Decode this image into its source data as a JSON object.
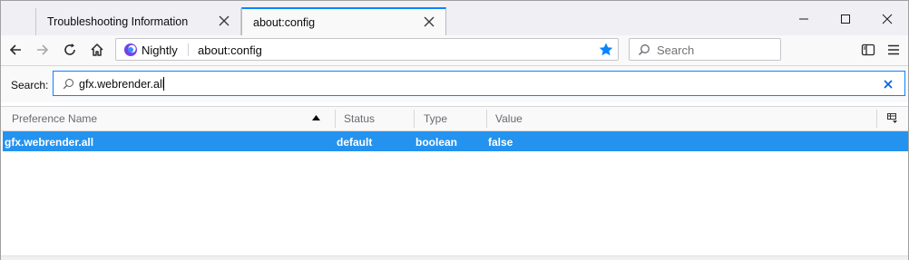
{
  "tabs": [
    {
      "label": "Troubleshooting Information",
      "active": false
    },
    {
      "label": "about:config",
      "active": true
    }
  ],
  "urlbar": {
    "identity": "Nightly",
    "url": "about:config"
  },
  "websearch": {
    "placeholder": "Search"
  },
  "config_search": {
    "label": "Search:",
    "value": "gfx.webrender.all"
  },
  "table": {
    "columns": [
      "Preference Name",
      "Status",
      "Type",
      "Value"
    ],
    "rows": [
      {
        "name": "gfx.webrender.all",
        "status": "default",
        "type": "boolean",
        "value": "false"
      }
    ]
  },
  "colors": {
    "accent": "#0a84ff",
    "selected_row": "#2493f0",
    "bookmark_star": "#0a84ff"
  },
  "icons": [
    "close-icon",
    "minimize-icon",
    "maximize-icon",
    "back-icon",
    "forward-icon",
    "reload-icon",
    "home-icon",
    "nightly-logo-icon",
    "bookmark-star-icon",
    "search-icon",
    "sidebar-icon",
    "menu-icon",
    "sort-ascending-icon",
    "column-picker-icon"
  ]
}
